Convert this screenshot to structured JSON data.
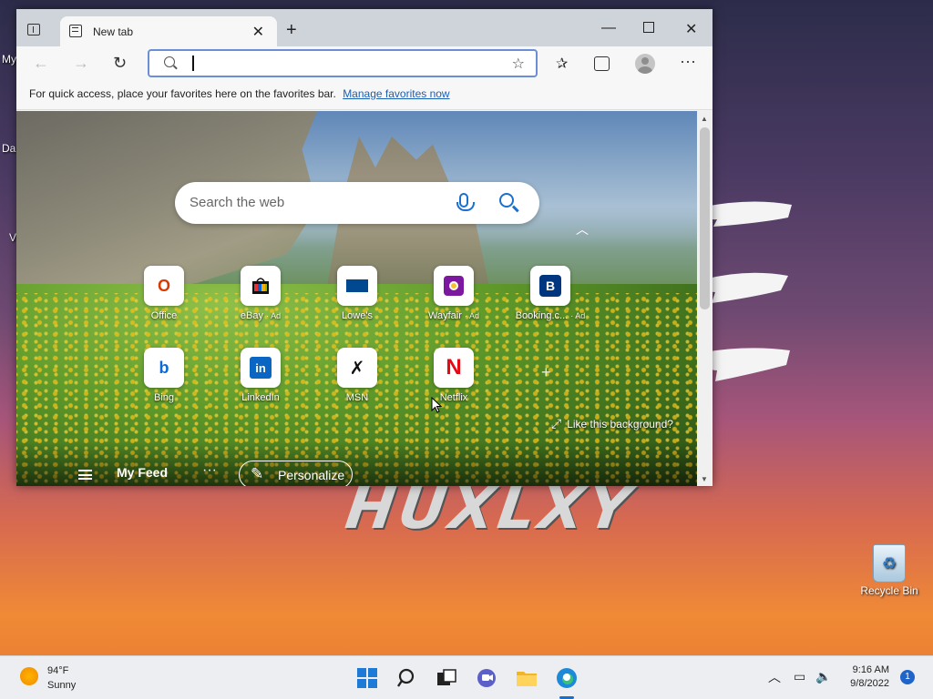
{
  "desktop": {
    "watermark": "HUXLXY",
    "recycle_bin_label": "Recycle Bin",
    "left_fragments": [
      "My",
      "Da",
      "V"
    ]
  },
  "browser": {
    "tab_title": "New tab",
    "address_value": "",
    "favorites_bar_text": "For quick access, place your favorites here on the favorites bar.",
    "favorites_bar_link": "Manage favorites now"
  },
  "newtab": {
    "search_placeholder": "Search the web",
    "quick_links": [
      {
        "label": "Office",
        "ad": "",
        "icon": "office-icon",
        "color": "#d83b01"
      },
      {
        "label": "eBay",
        "ad": "· Ad",
        "icon": "ebay-icon",
        "color": "#111111"
      },
      {
        "label": "Lowe's",
        "ad": "",
        "icon": "lowes-icon",
        "color": "#004990"
      },
      {
        "label": "Wayfair",
        "ad": "· Ad",
        "icon": "wayfair-icon",
        "color": "#7b189f"
      },
      {
        "label": "Booking.c...",
        "ad": "· Ad",
        "icon": "booking-icon",
        "color": "#003580"
      },
      {
        "label": "Bing",
        "ad": "",
        "icon": "bing-icon",
        "color": "#0b6ad8"
      },
      {
        "label": "LinkedIn",
        "ad": "",
        "icon": "linkedin-icon",
        "color": "#0a66c2"
      },
      {
        "label": "MSN",
        "ad": "",
        "icon": "msn-icon",
        "color": "#111111"
      },
      {
        "label": "Netflix",
        "ad": "",
        "icon": "netflix-icon",
        "color": "#e50914"
      }
    ],
    "like_background": "Like this background?",
    "feed_label": "My Feed",
    "personalize_label": "Personalize"
  },
  "taskbar": {
    "weather_temp": "94°F",
    "weather_condition": "Sunny",
    "time": "9:16 AM",
    "date": "9/8/2022",
    "notification_count": "1"
  }
}
